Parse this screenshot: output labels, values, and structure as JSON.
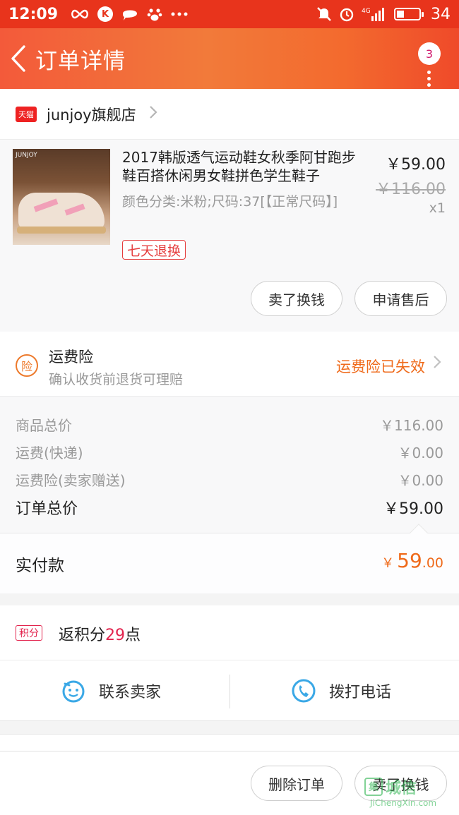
{
  "status_bar": {
    "time": "12:09",
    "k_icon": "K",
    "network": "4G",
    "battery": "34",
    "battery_level": 0.34
  },
  "header": {
    "title": "订单详情",
    "badge_count": "3"
  },
  "shop": {
    "tag": "天猫",
    "name": "junjoy旗舰店"
  },
  "product": {
    "image_brand": "JUNJOY",
    "title": "2017韩版透气运动鞋女秋季阿甘跑步鞋百搭休闲男女鞋拼色学生鞋子",
    "spec": "颜色分类:米粉;尺码:37[【正常尺码】]",
    "tag": "七天退换",
    "price": "￥59.00",
    "original_price": "￥116.00",
    "quantity": "x1",
    "buttons": [
      "卖了换钱",
      "申请售后"
    ]
  },
  "insurance": {
    "icon_text": "险",
    "title": "运费险",
    "desc": "确认收货前退货可理赔",
    "status": "运费险已失效"
  },
  "costs": [
    {
      "label": "商品总价",
      "value": "￥116.00"
    },
    {
      "label": "运费(快递)",
      "value": "￥0.00"
    },
    {
      "label": "运费险(卖家赠送)",
      "value": "￥0.00"
    }
  ],
  "order_total": {
    "label": "订单总价",
    "value": "￥59.00"
  },
  "paid": {
    "label": "实付款",
    "currency": "￥",
    "integer": "59",
    "decimal": ".00"
  },
  "points": {
    "tag": "积分",
    "prefix": "返积分",
    "value": "29",
    "suffix": "点"
  },
  "contact": {
    "seller": "联系卖家",
    "phone": "拨打电话"
  },
  "bottom_buttons": [
    "删除订单",
    "卖了换钱"
  ],
  "watermark": {
    "main": "城信",
    "box": "集",
    "url": "JiChengXin.com"
  },
  "colors": {
    "status_bar": "#e8341c",
    "accent_orange": "#ef6a1a",
    "accent_red": "#e53e3e",
    "points_red": "#e2234d",
    "icon_blue": "#3aa8e6"
  }
}
